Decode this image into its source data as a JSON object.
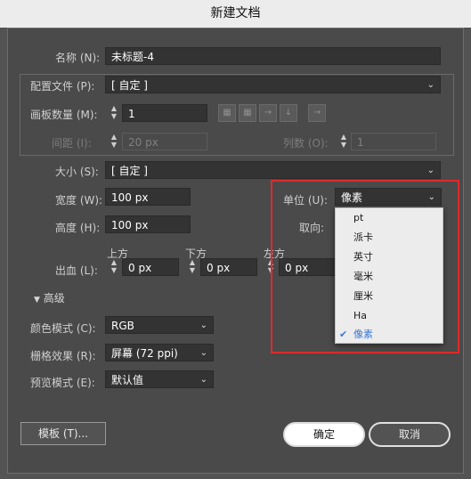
{
  "window": {
    "title": "新建文档"
  },
  "name": {
    "label": "名称 (N):",
    "value": "未标题-4"
  },
  "profile": {
    "label": "配置文件 (P):",
    "value": "[ 自定 ]"
  },
  "artboards": {
    "label": "画板数量 (M):",
    "value": "1"
  },
  "spacing": {
    "label": "间距 (I):",
    "value": "20 px"
  },
  "columns": {
    "label": "列数 (O):",
    "value": "1"
  },
  "size": {
    "label": "大小 (S):",
    "value": "[ 自定 ]"
  },
  "width": {
    "label": "宽度 (W):",
    "value": "100 px"
  },
  "height": {
    "label": "高度 (H):",
    "value": "100 px"
  },
  "units": {
    "label": "单位 (U):",
    "value": "像素"
  },
  "orientation": {
    "label": "取向:"
  },
  "bleed": {
    "label": "出血 (L):",
    "top_label": "上方",
    "top": "0 px",
    "bottom_label": "下方",
    "bottom": "0 px",
    "left_label": "左方",
    "left": "0 px"
  },
  "advanced": {
    "label": "高级"
  },
  "color_mode": {
    "label": "颜色模式 (C):",
    "value": "RGB"
  },
  "raster": {
    "label": "栅格效果 (R):",
    "value": "屏幕 (72 ppi)"
  },
  "preview": {
    "label": "预览模式 (E):",
    "value": "默认值"
  },
  "units_menu": {
    "options": [
      "pt",
      "派卡",
      "英寸",
      "毫米",
      "厘米",
      "Ha",
      "像素"
    ],
    "selected_index": 6
  },
  "buttons": {
    "templates": "模板 (T)...",
    "ok": "确定",
    "cancel": "取消"
  },
  "colors": {
    "highlight_border": "#e02a2a",
    "selected_item": "#3a78d8"
  }
}
